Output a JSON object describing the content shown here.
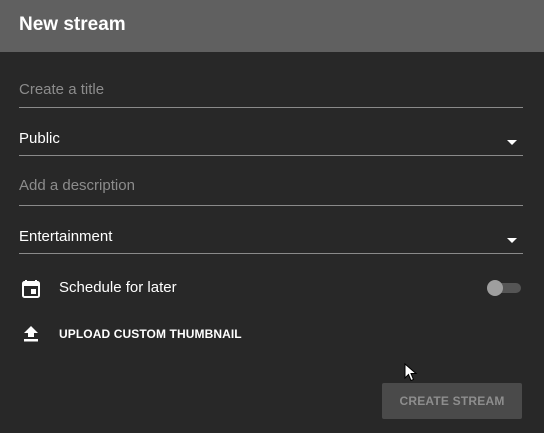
{
  "header": {
    "title": "New stream"
  },
  "title_field": {
    "placeholder": "Create a title",
    "value": ""
  },
  "visibility_select": {
    "value": "Public",
    "icon": "chevron-down-icon"
  },
  "description_field": {
    "placeholder": "Add a description",
    "value": ""
  },
  "category_select": {
    "value": "Entertainment",
    "icon": "chevron-down-icon"
  },
  "schedule": {
    "label": "Schedule for later",
    "icon": "calendar-icon",
    "enabled": false
  },
  "upload": {
    "label": "UPLOAD CUSTOM THUMBNAIL",
    "icon": "upload-icon"
  },
  "actions": {
    "create_label": "CREATE STREAM"
  },
  "colors": {
    "header_bg": "#606060",
    "dialog_bg": "#282828",
    "button_bg": "#4a4a4a",
    "button_text_disabled": "#8e8e8e"
  }
}
